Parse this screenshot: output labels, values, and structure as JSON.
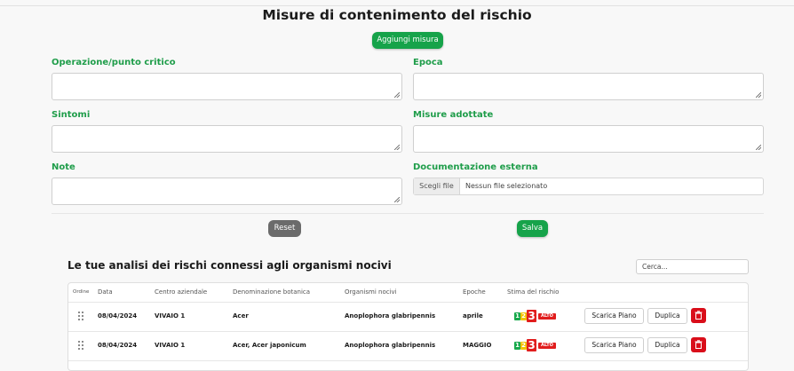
{
  "page": {
    "title": "Misure di contenimento del rischio"
  },
  "actions": {
    "add_measure": "Aggiungi misura",
    "reset": "Reset",
    "save": "Salva"
  },
  "form": {
    "operazione_label": "Operazione/punto critico",
    "epoca_label": "Epoca",
    "sintomi_label": "Sintomi",
    "misure_label": "Misure adottate",
    "note_label": "Note",
    "documentazione_label": "Documentazione esterna",
    "file_choose": "Scegli file",
    "file_status": "Nessun file selezionato"
  },
  "analyses": {
    "title": "Le tue analisi dei rischi connessi agli organismi nocivi",
    "search_placeholder": "Cerca...",
    "columns": [
      "Ordine",
      "Data",
      "Centro aziendale",
      "Denominazione botanica",
      "Organismi nocivi",
      "Epoche",
      "Stima del rischio"
    ],
    "rows": [
      {
        "data": "08/04/2024",
        "centro": "VIVAIO 1",
        "denominazione": "Acer",
        "organismi": "Anoplophora glabripennis",
        "epoche": "aprile",
        "risk": [
          "1",
          "2",
          "3"
        ],
        "risk_label": "ALTO",
        "download": "Scarica Piano",
        "duplicate": "Duplica"
      },
      {
        "data": "08/04/2024",
        "centro": "VIVAIO 1",
        "denominazione": "Acer, Acer japonicum",
        "organismi": "Anoplophora glabripennis",
        "epoche": "MAGGIO",
        "risk": [
          "1",
          "2",
          "3"
        ],
        "risk_label": "ALTO",
        "download": "Scarica Piano",
        "duplicate": "Duplica"
      }
    ]
  },
  "colors": {
    "accent": "#16a34a",
    "label": "#1f9d4a",
    "danger": "#d90e1a",
    "neutral": "#6b6b6b"
  },
  "icons": {
    "drag": "drag-handle-icon",
    "delete": "trash-icon",
    "resize": "resize-grip-icon"
  }
}
